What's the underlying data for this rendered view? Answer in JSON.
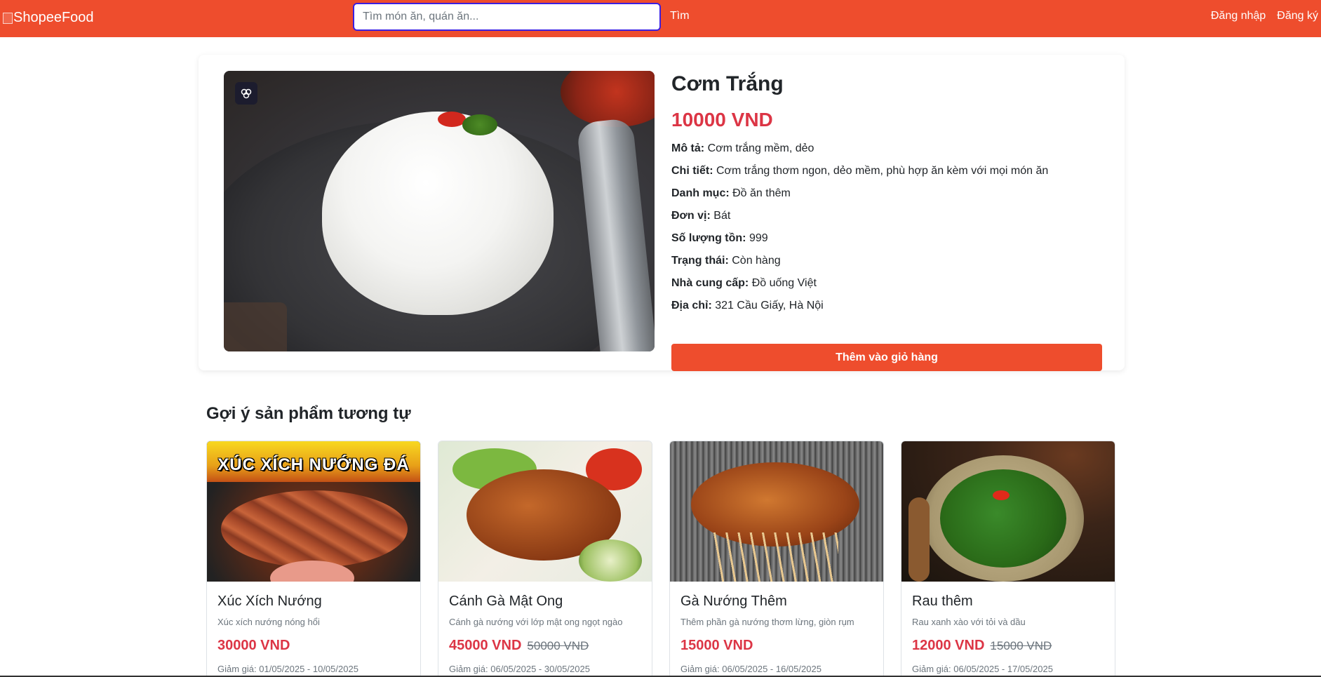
{
  "header": {
    "logo_text": "ShopeeFood",
    "search_placeholder": "Tìm món ăn, quán ăn...",
    "search_button": "Tìm",
    "login": "Đăng nhập",
    "register": "Đăng ký",
    "brand_color": "#ee4d2d"
  },
  "product": {
    "title": "Cơm Trắng",
    "price": "10000 VND",
    "details": [
      {
        "label": "Mô tả:",
        "value": "Cơm trắng mềm, dẻo"
      },
      {
        "label": "Chi tiết:",
        "value": "Cơm trắng thơm ngon, dẻo mềm, phù hợp ăn kèm với mọi món ăn"
      },
      {
        "label": "Danh mục:",
        "value": "Đồ ăn thêm"
      },
      {
        "label": "Đơn vị:",
        "value": "Bát"
      },
      {
        "label": "Số lượng tồn:",
        "value": "999"
      },
      {
        "label": "Trạng thái:",
        "value": "Còn hàng"
      },
      {
        "label": "Nhà cung cấp:",
        "value": "Đồ uống Việt"
      },
      {
        "label": "Địa chỉ:",
        "value": "321 Cầu Giấy, Hà Nội"
      }
    ],
    "add_to_cart": "Thêm vào giỏ hàng",
    "image_icon": "brain-icon"
  },
  "suggestions": {
    "title": "Gợi ý sản phẩm tương tự",
    "items": [
      {
        "name": "Xúc Xích Nướng",
        "desc": "Xúc xích nướng nóng hổi",
        "price": "30000 VND",
        "old_price": "",
        "discount": "Giảm giá: 01/05/2025 - 10/05/2025",
        "banner": "XÚC XÍCH NƯỚNG ĐÁ"
      },
      {
        "name": "Cánh Gà Mật Ong",
        "desc": "Cánh gà nướng với lớp mật ong ngọt ngào",
        "price": "45000 VND",
        "old_price": "50000 VND",
        "discount": "Giảm giá: 06/05/2025 - 30/05/2025"
      },
      {
        "name": "Gà Nướng Thêm",
        "desc": "Thêm phần gà nướng thơm lừng, giòn rụm",
        "price": "15000 VND",
        "old_price": "",
        "discount": "Giảm giá: 06/05/2025 - 16/05/2025"
      },
      {
        "name": "Rau thêm",
        "desc": "Rau xanh xào với tỏi và dầu",
        "price": "12000 VND",
        "old_price": "15000 VND",
        "discount": "Giảm giá: 06/05/2025 - 17/05/2025"
      }
    ]
  }
}
